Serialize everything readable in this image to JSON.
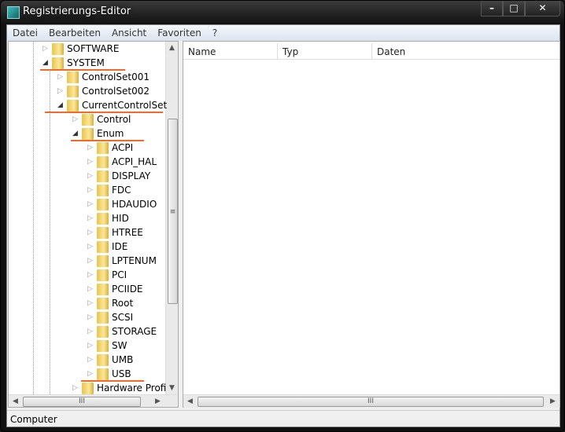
{
  "window": {
    "title": "Registrierungs-Editor",
    "minimize": "–",
    "maximize": "□",
    "close": "✕"
  },
  "menu": [
    "Datei",
    "Bearbeiten",
    "Ansicht",
    "Favoriten",
    "?"
  ],
  "tree": [
    {
      "label": "SOFTWARE",
      "level": 1,
      "expanded": false
    },
    {
      "label": "SYSTEM",
      "level": 1,
      "expanded": true,
      "highlighted": true
    },
    {
      "label": "ControlSet001",
      "level": 2,
      "expanded": false
    },
    {
      "label": "ControlSet002",
      "level": 2,
      "expanded": false
    },
    {
      "label": "CurrentControlSet",
      "level": 2,
      "expanded": true,
      "highlighted": true
    },
    {
      "label": "Control",
      "level": 3,
      "expanded": false
    },
    {
      "label": "Enum",
      "level": 3,
      "expanded": true,
      "highlighted": true
    },
    {
      "label": "ACPI",
      "level": 4,
      "expanded": false
    },
    {
      "label": "ACPI_HAL",
      "level": 4,
      "expanded": false
    },
    {
      "label": "DISPLAY",
      "level": 4,
      "expanded": false
    },
    {
      "label": "FDC",
      "level": 4,
      "expanded": false
    },
    {
      "label": "HDAUDIO",
      "level": 4,
      "expanded": false
    },
    {
      "label": "HID",
      "level": 4,
      "expanded": false
    },
    {
      "label": "HTREE",
      "level": 4,
      "expanded": false
    },
    {
      "label": "IDE",
      "level": 4,
      "expanded": false
    },
    {
      "label": "LPTENUM",
      "level": 4,
      "expanded": false
    },
    {
      "label": "PCI",
      "level": 4,
      "expanded": false
    },
    {
      "label": "PCIIDE",
      "level": 4,
      "expanded": false
    },
    {
      "label": "Root",
      "level": 4,
      "expanded": false
    },
    {
      "label": "SCSI",
      "level": 4,
      "expanded": false
    },
    {
      "label": "STORAGE",
      "level": 4,
      "expanded": false
    },
    {
      "label": "SW",
      "level": 4,
      "expanded": false
    },
    {
      "label": "UMB",
      "level": 4,
      "expanded": false
    },
    {
      "label": "USB",
      "level": 4,
      "expanded": false,
      "highlighted": true
    },
    {
      "label": "Hardware Profi",
      "level": 3,
      "expanded": false
    }
  ],
  "columns": [
    "Name",
    "Typ",
    "Daten"
  ],
  "status": "Computer",
  "colors": {
    "highlight": "#f06a2a",
    "folder": "#f0d070"
  }
}
